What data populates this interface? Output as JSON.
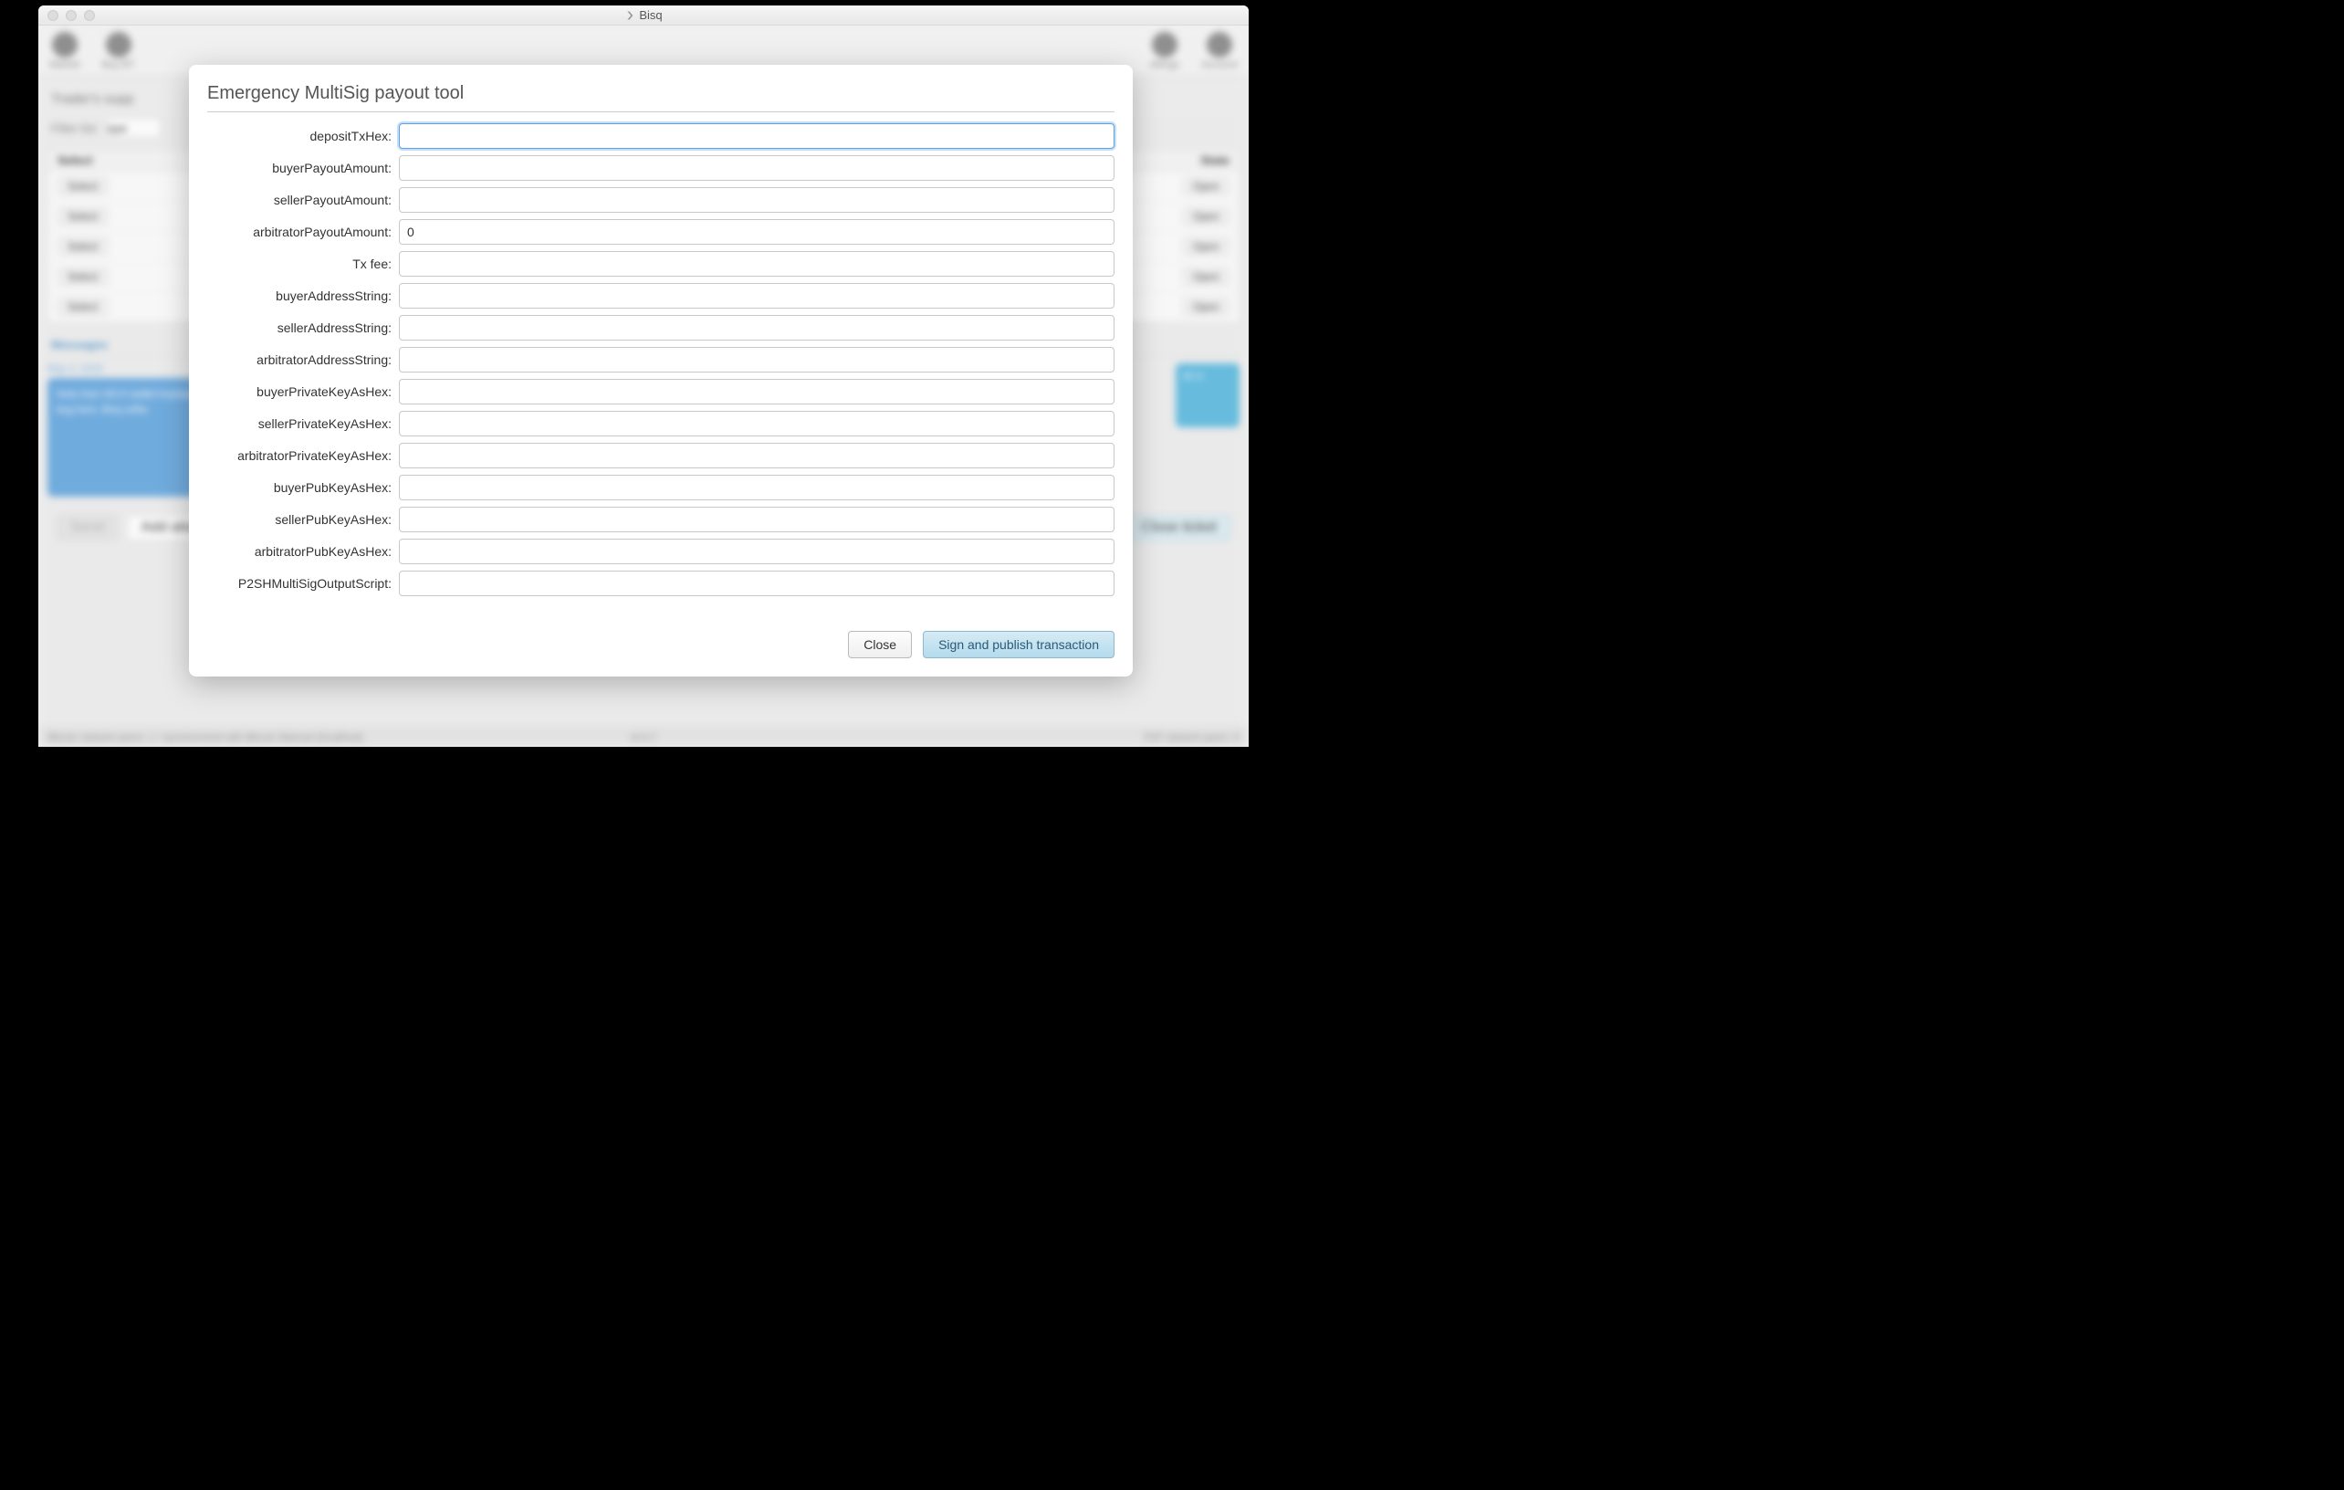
{
  "window": {
    "title": "Bisq"
  },
  "background": {
    "nav_left": [
      "Market",
      "Buy BT"
    ],
    "nav_right": [
      "ettings",
      "Account"
    ],
    "section_title": "Trader's supp",
    "filter_label": "Filter list:",
    "filter_value": "ope",
    "table": {
      "header_left": "Select",
      "header_right": "State",
      "rows": [
        {
          "left": "Select",
          "right": "Open"
        },
        {
          "left": "Select",
          "right": "Open"
        },
        {
          "left": "Select",
          "right": "Open"
        },
        {
          "left": "Select",
          "right": "Open"
        },
        {
          "left": "Select",
          "right": "Open"
        }
      ]
    },
    "tabs": "Messages",
    "msg_date": "May 2, 2018",
    "msg_left": "Note that t\nBCH wallet\nKeybase wi\nbug here. \nBisq softw",
    "msg_right": "eir\n\na",
    "send": "Send",
    "attach": "Add attachments",
    "close_ticket": "Close ticket",
    "status_left": "Bitcoin network peers: 1 / synchronized with Bitcoin Mainnet (localhost)",
    "status_center": "v0.6.7",
    "status_right": "P2P network peers: 9"
  },
  "dialog": {
    "title": "Emergency MultiSig payout tool",
    "fields": [
      {
        "label": "depositTxHex:",
        "value": "",
        "focused": true
      },
      {
        "label": "buyerPayoutAmount:",
        "value": ""
      },
      {
        "label": "sellerPayoutAmount:",
        "value": ""
      },
      {
        "label": "arbitratorPayoutAmount:",
        "value": "0"
      },
      {
        "label": "Tx fee:",
        "value": ""
      },
      {
        "label": "buyerAddressString:",
        "value": ""
      },
      {
        "label": "sellerAddressString:",
        "value": ""
      },
      {
        "label": "arbitratorAddressString:",
        "value": ""
      },
      {
        "label": "buyerPrivateKeyAsHex:",
        "value": ""
      },
      {
        "label": "sellerPrivateKeyAsHex:",
        "value": ""
      },
      {
        "label": "arbitratorPrivateKeyAsHex:",
        "value": ""
      },
      {
        "label": "buyerPubKeyAsHex:",
        "value": ""
      },
      {
        "label": "sellerPubKeyAsHex:",
        "value": ""
      },
      {
        "label": "arbitratorPubKeyAsHex:",
        "value": ""
      },
      {
        "label": "P2SHMultiSigOutputScript:",
        "value": ""
      }
    ],
    "close_btn": "Close",
    "sign_btn": "Sign and publish transaction"
  }
}
